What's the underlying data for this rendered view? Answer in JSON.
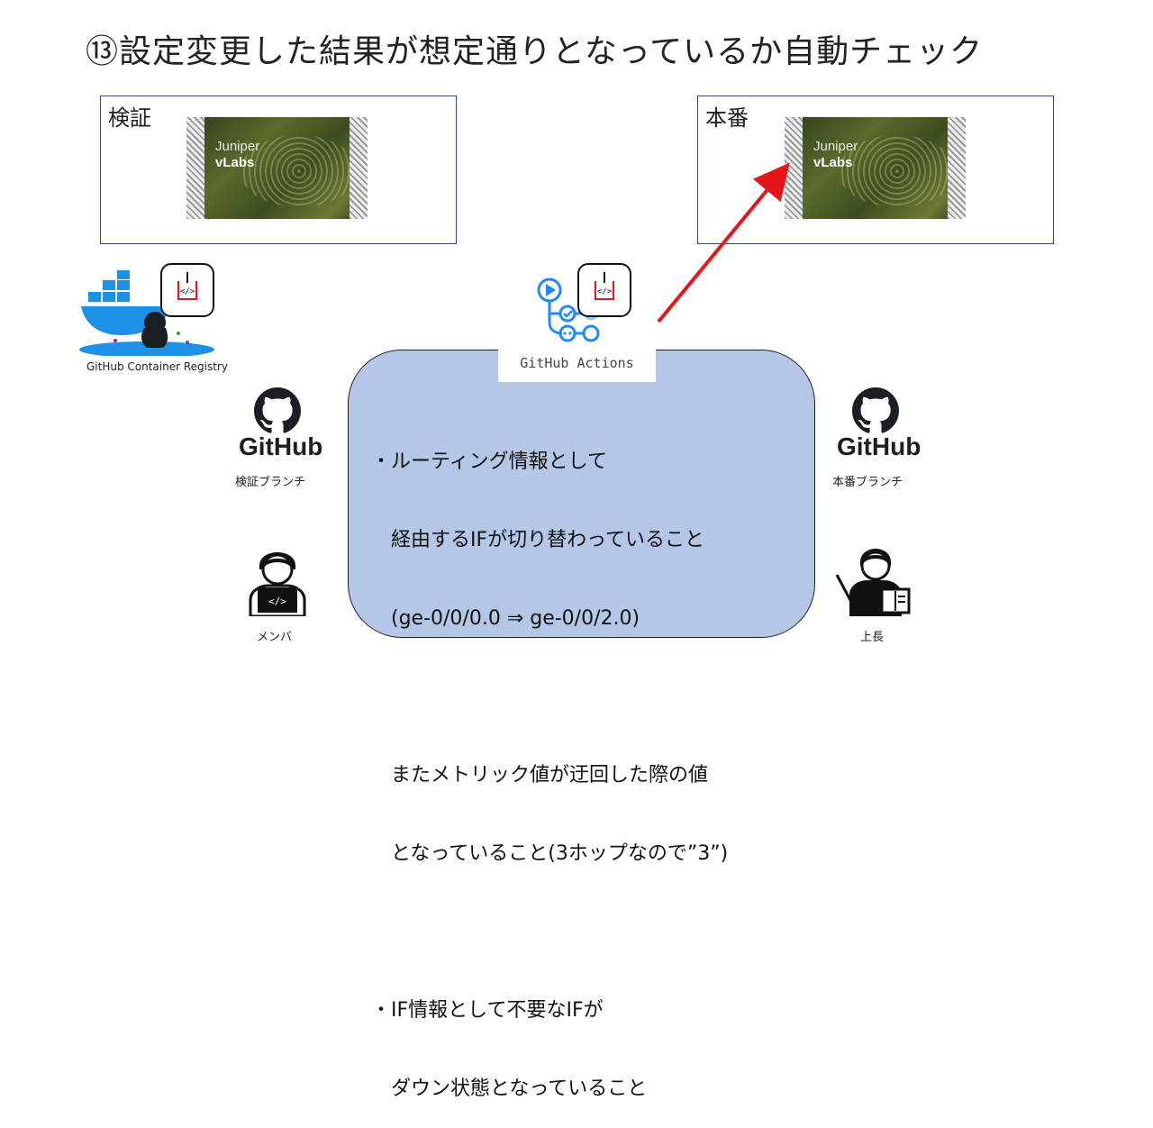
{
  "slide": {
    "title": "⑬設定変更した結果が想定通りとなっているか自動チェック"
  },
  "environments": {
    "staging": {
      "label": "検証",
      "logo_line1": "Juniper",
      "logo_line2": "vLabs"
    },
    "production": {
      "label": "本番",
      "logo_line1": "Juniper",
      "logo_line2": "vLabs"
    }
  },
  "registry": {
    "label": "GitHub Container Registry"
  },
  "actions": {
    "label": "GitHub Actions"
  },
  "github_left": {
    "wordmark": "GitHub",
    "caption": "検証ブランチ"
  },
  "github_right": {
    "wordmark": "GitHub",
    "caption": "本番ブランチ"
  },
  "people": {
    "member": {
      "caption": "メンバ"
    },
    "boss": {
      "caption": "上長"
    }
  },
  "checks": {
    "lines": [
      "・ルーティング情報として",
      "　経由するIFが切り替わっていること",
      "　(ge-0/0/0.0 ⇒ ge-0/0/2.0)",
      "",
      "　またメトリック値が迂回した際の値",
      "　となっていること(3ホップなので”3”)",
      "",
      "・IF情報として不要なIFが",
      "　ダウン状態となっていること"
    ]
  },
  "colors": {
    "arrow": "#e8141b",
    "box_fill": "#b4c7e7",
    "docker_blue": "#1d91e6",
    "actions_blue": "#2188ff"
  },
  "icons": [
    "docker-whale-icon",
    "code-badge-icon",
    "github-actions-icon",
    "github-octocat-icon",
    "developer-icon",
    "teacher-icon"
  ]
}
